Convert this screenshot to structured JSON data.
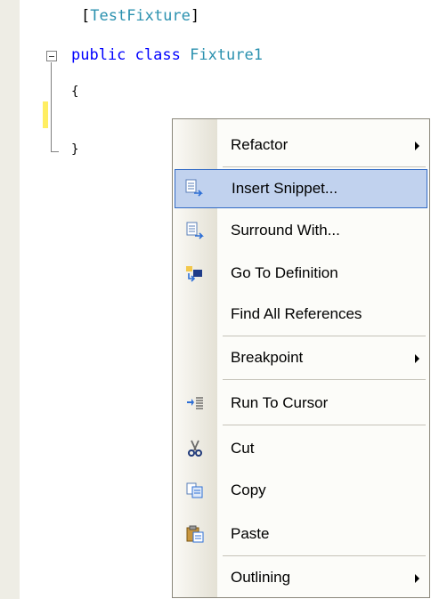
{
  "code": {
    "attribute_open": "[",
    "attribute_name": "TestFixture",
    "attribute_close": "]",
    "kw_public": "public",
    "kw_class": "class",
    "class_name": "Fixture1",
    "brace_open": "{",
    "brace_close": "}"
  },
  "context_menu": {
    "items": [
      {
        "label": "Refactor",
        "icon": "none",
        "submenu": true
      },
      {
        "label": "Insert Snippet...",
        "icon": "insert-snippet-icon",
        "highlighted": true
      },
      {
        "label": "Surround With...",
        "icon": "surround-with-icon"
      },
      {
        "label": "Go To Definition",
        "icon": "go-to-definition-icon"
      },
      {
        "label": "Find All References",
        "icon": "none"
      },
      {
        "label": "Breakpoint",
        "icon": "none",
        "submenu": true
      },
      {
        "label": "Run To Cursor",
        "icon": "run-to-cursor-icon"
      },
      {
        "label": "Cut",
        "icon": "scissors-icon"
      },
      {
        "label": "Copy",
        "icon": "copy-icon"
      },
      {
        "label": "Paste",
        "icon": "paste-icon"
      },
      {
        "label": "Outlining",
        "icon": "none",
        "submenu": true
      }
    ]
  },
  "colors": {
    "keyword": "#0000ff",
    "type": "#2b91af",
    "highlight_bg": "#c1d2ee",
    "highlight_border": "#316ac5"
  }
}
